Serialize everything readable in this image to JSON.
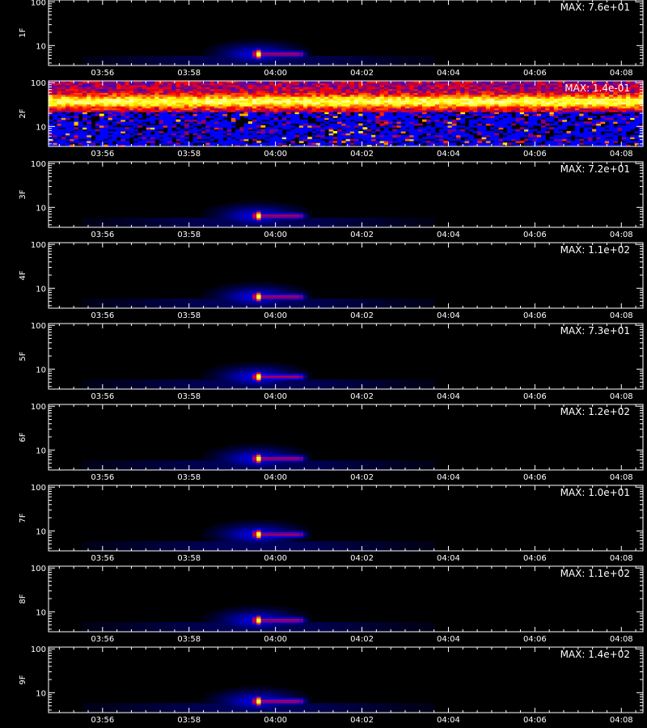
{
  "chart_data": {
    "type": "heatmap",
    "colormap": [
      "#000000",
      "#0000ff",
      "#ff0000",
      "#ffff00",
      "#ffffff"
    ],
    "x_range": [
      "03:54:45",
      "04:08:30"
    ],
    "x_tick_labels": [
      "03:56",
      "03:58",
      "04:00",
      "04:02",
      "04:04",
      "04:06",
      "04:08"
    ],
    "y_scale": "log",
    "y_range": [
      3.5,
      110
    ],
    "y_tick_labels": [
      "10",
      "100"
    ],
    "x_axis_title": "",
    "panels": [
      {
        "label": "1F",
        "max_text": "MAX: 7.6e+01",
        "pattern": "burst",
        "burst_time": "03:59:35",
        "tail_end": "04:00:35",
        "burst_energy": 6.5
      },
      {
        "label": "2F",
        "max_text": "MAX: 1.4e-01",
        "pattern": "noise"
      },
      {
        "label": "3F",
        "max_text": "MAX: 7.2e+01",
        "pattern": "burst",
        "burst_time": "03:59:35",
        "tail_end": "04:00:35",
        "burst_energy": 6.5
      },
      {
        "label": "4F",
        "max_text": "MAX: 1.1e+02",
        "pattern": "burst",
        "burst_time": "03:59:35",
        "tail_end": "04:00:35",
        "burst_energy": 6.5
      },
      {
        "label": "5F",
        "max_text": "MAX: 7.3e+01",
        "pattern": "burst",
        "burst_time": "03:59:35",
        "tail_end": "04:00:35",
        "burst_energy": 6.8
      },
      {
        "label": "6F",
        "max_text": "MAX: 1.2e+02",
        "pattern": "burst",
        "burst_time": "03:59:35",
        "tail_end": "04:00:35",
        "burst_energy": 6.5
      },
      {
        "label": "7F",
        "max_text": "MAX: 1.0e+01",
        "pattern": "burst",
        "burst_time": "03:59:35",
        "tail_end": "04:00:35",
        "burst_energy": 8.5
      },
      {
        "label": "8F",
        "max_text": "MAX: 1.1e+02",
        "pattern": "burst",
        "burst_time": "03:59:35",
        "tail_end": "04:00:35",
        "burst_energy": 6.5
      },
      {
        "label": "9F",
        "max_text": "MAX: 1.4e+02",
        "pattern": "burst",
        "burst_time": "03:59:35",
        "tail_end": "04:00:35",
        "burst_energy": 6.5
      }
    ]
  }
}
